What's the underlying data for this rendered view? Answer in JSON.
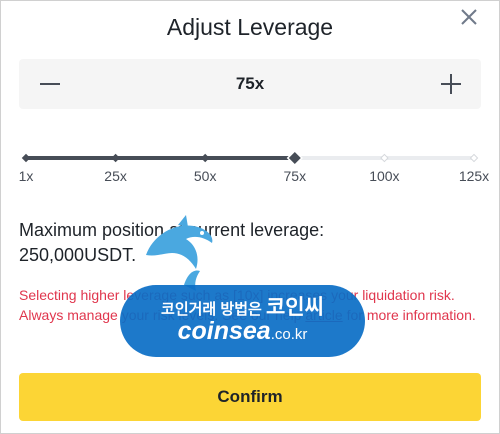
{
  "dialog": {
    "title": "Adjust Leverage",
    "close_icon": "close-icon"
  },
  "stepper": {
    "value": "75x",
    "minus_icon": "minus-icon",
    "plus_icon": "plus-icon"
  },
  "slider": {
    "marks": [
      "1x",
      "25x",
      "50x",
      "75x",
      "100x",
      "125x"
    ],
    "current_index": 3,
    "active_color": "#474d57",
    "inactive_color": "#eaecef"
  },
  "info": {
    "max_position_line1": "Maximum position at current leverage:",
    "max_position_line2": "250,000USDT."
  },
  "warning": {
    "text_before": "Selecting higher leverage such as [10x] increases your liquidation risk. Always manage your risk levels. See our help ",
    "link_text": "article",
    "text_after": " for more information.",
    "color": "#e0364d"
  },
  "confirm": {
    "label": "Confirm",
    "color": "#fcd535"
  },
  "watermark": {
    "line1_small": "코인거래 방법은",
    "line1_big": "코인씨",
    "domain": "coinsea",
    "tld": ".co.kr",
    "color": "#0a6ec6"
  }
}
